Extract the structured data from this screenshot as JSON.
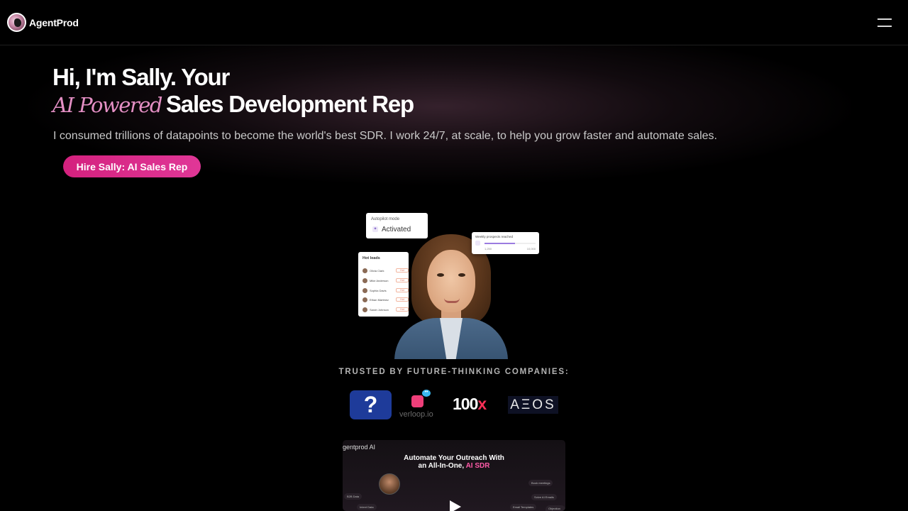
{
  "header": {
    "brand": "AgentProd"
  },
  "hero": {
    "title_line1": "Hi, I'm Sally. Your",
    "title_accent": "AI Powered",
    "title_line2": "Sales Development Rep",
    "subtitle": "I consumed trillions of datapoints to become the world's best SDR. I work 24/7, at scale, to help you grow faster and automate sales.",
    "cta_label": "Hire Sally: AI Sales Rep"
  },
  "illustration": {
    "autopilot": {
      "title": "Autopilot mode",
      "value": "Activated"
    },
    "prospects": {
      "title": "Weekly prospects reached",
      "min": "1,250",
      "max": "10,000",
      "fill_fraction": 0.6
    },
    "leads": {
      "title": "Hot leads",
      "items": [
        {
          "name": "Olivia Clark",
          "tag": "Hot"
        },
        {
          "name": "Mike Anderson",
          "tag": "Hot"
        },
        {
          "name": "Sophia Davis",
          "tag": "Hot"
        },
        {
          "name": "Ethan Martinez",
          "tag": "Hot"
        },
        {
          "name": "Sarah Johnson",
          "tag": "Hot"
        }
      ]
    }
  },
  "trusted": {
    "label": "TRUSTED BY FUTURE-THINKING COMPANIES:",
    "logos": [
      {
        "name": "p-logo",
        "text": "?"
      },
      {
        "name": "verloop-logo",
        "text": "verloop.io"
      },
      {
        "name": "100x-logo",
        "text": "100",
        "accent": "x"
      },
      {
        "name": "aeos-logo",
        "text": "AΞOS"
      }
    ]
  },
  "video": {
    "brand": "gentprod AI",
    "title_line1": "Automate Your Outreach With",
    "title_line2": "an All-In-One,",
    "title_accent": "AI SDR",
    "chips": [
      "B2B Data",
      "Intent Data",
      "Book meetings",
      "Solve AI Emails",
      "Email Templates",
      "Objection Handling"
    ]
  },
  "colors": {
    "accent_pink": "#e48fc4",
    "cta": "#d4217e",
    "background": "#000000"
  }
}
